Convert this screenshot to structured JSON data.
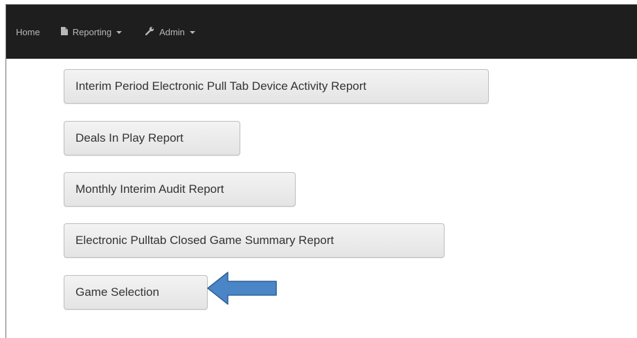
{
  "navbar": {
    "home_label": "Home",
    "reporting_label": "Reporting",
    "admin_label": "Admin",
    "icons": {
      "reporting": "document-icon",
      "admin": "wrench-icon"
    },
    "background": "#1e1e1e",
    "text_color": "#b8b8b8"
  },
  "reports": {
    "interim_epd_label": "Interim Period Electronic Pull Tab Device Activity Report",
    "deals_in_play_label": "Deals In Play Report",
    "monthly_interim_audit_label": "Monthly Interim Audit Report",
    "closed_game_summary_label": "Electronic Pulltab Closed Game Summary Report",
    "game_selection_label": "Game Selection"
  },
  "annotation": {
    "arrow_color": "#3f7fc1"
  }
}
